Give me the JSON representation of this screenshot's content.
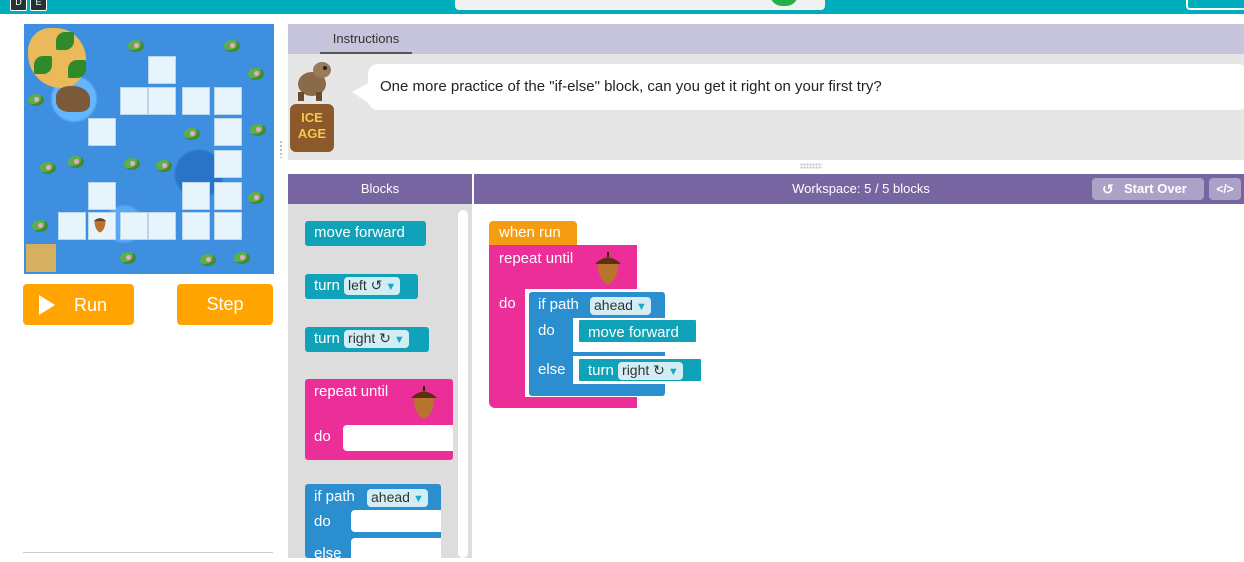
{
  "topbar": {
    "box1": "D",
    "box2": "E"
  },
  "controls": {
    "run_label": "Run",
    "step_label": "Step"
  },
  "instructions": {
    "tab_label": "Instructions",
    "text": "One more practice of the \"if-else\" block, can you get it right on your first try?",
    "logo_text": "ICE AGE"
  },
  "headers": {
    "blocks": "Blocks",
    "workspace": "Workspace: 5 / 5 blocks",
    "start_over": "Start Over",
    "show_code": "</>"
  },
  "toolbox": {
    "move_forward": "move forward",
    "turn_left_prefix": "turn",
    "turn_left_value": "left ↺",
    "turn_right_prefix": "turn",
    "turn_right_value": "right ↻",
    "repeat_until": "repeat until",
    "repeat_do": "do",
    "if_path": "if path",
    "if_path_value": "ahead",
    "if_do": "do",
    "if_else": "else"
  },
  "workspace": {
    "when_run": "when run",
    "repeat_until": "repeat until",
    "repeat_do": "do",
    "if_path": "if path",
    "if_path_value": "ahead",
    "if_do": "do",
    "move_forward": "move forward",
    "if_else": "else",
    "turn_prefix": "turn",
    "turn_value": "right ↻"
  },
  "colors": {
    "accent_teal": "#00adbc",
    "run_orange": "#ffa400",
    "header_purple": "#7665a0",
    "block_teal": "#0fa2b8",
    "block_blue": "#2b8fcf",
    "block_pink": "#ec2e98",
    "block_orange": "#f59d12"
  }
}
